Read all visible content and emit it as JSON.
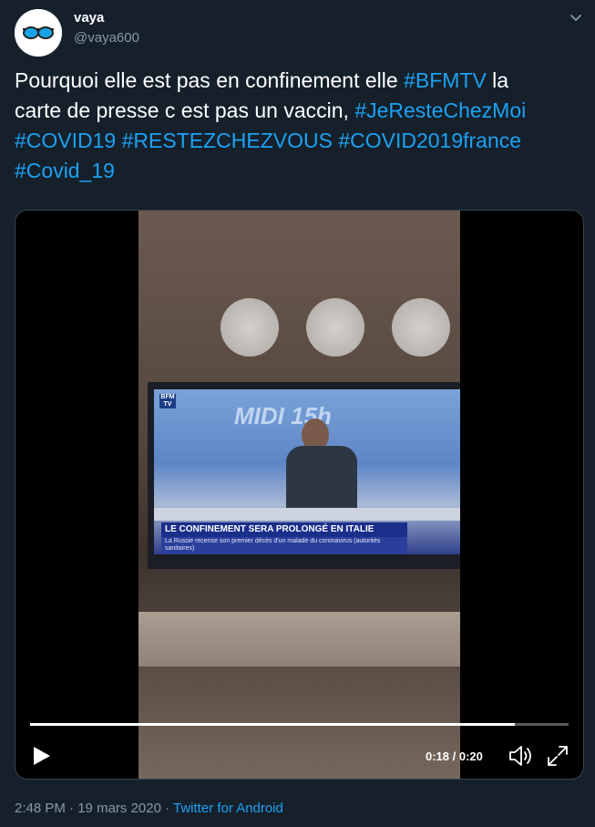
{
  "author": {
    "name": "vaya",
    "handle": "@vaya600"
  },
  "tweet": {
    "text_line1_plain": "Pourquoi elle est pas en confinement elle ",
    "tag_bfmtv": "#BFMTV",
    "text_line1_tail": "  la",
    "text_line2_plain": "carte de presse c est pas un vaccin, ",
    "tag_jeresteChezMoi": "#JeResteChezMoi",
    "tag_covid19": "#COVID19",
    "tag_restezchezvous": "#RESTEZCHEZVOUS",
    "tag_covid2019france": "#COVID2019france",
    "tag_covid_19": "#Covid_19"
  },
  "video": {
    "tv_logo": "BFM TV",
    "tv_show": "MIDI 15h",
    "lower_third": "LE CONFINEMENT SERA PROLONGÉ EN ITALIE",
    "ticker": "La Russie recense son premier décès d'un malade du coronavirus (autorités sanitaires)",
    "progress": 0.9,
    "time": "0:18 / 0:20"
  },
  "meta": {
    "time": "2:48 PM",
    "separator1": " · ",
    "date": "19 mars 2020",
    "separator2": " · ",
    "source": "Twitter for Android"
  },
  "colors": {
    "background": "#15202b",
    "link": "#1da1f2",
    "secondary": "#8899a6"
  },
  "icons": {
    "avatar": "sunglasses-icon",
    "caret": "chevron-down-icon",
    "play": "play-icon",
    "volume": "volume-icon",
    "fullscreen": "fullscreen-icon"
  }
}
